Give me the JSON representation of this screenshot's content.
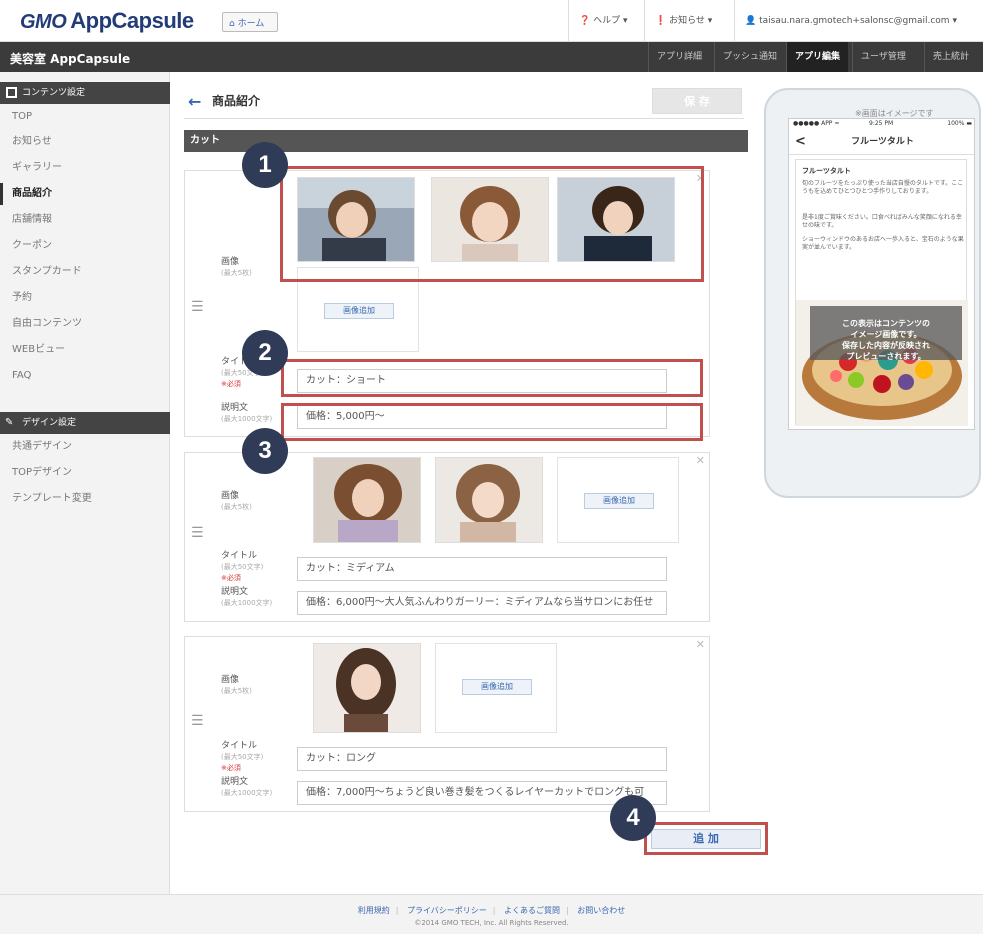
{
  "header": {
    "logo_prefix": "GMO",
    "logo_text": "AppCapsule",
    "home_label": "ホーム",
    "help_label": "ヘルプ ▾",
    "notice_label": "お知らせ ▾",
    "user_label": "taisau.nara.gmotech+salonsc@gmail.com ▾"
  },
  "appbar": {
    "app_name": "美容室 AppCapsule",
    "tabs": [
      "アプリ詳細",
      "プッシュ通知",
      "アプリ編集",
      "ユーザ管理",
      "売上統計"
    ]
  },
  "sidebar": {
    "content_header": "コンテンツ設定",
    "items": [
      "TOP",
      "お知らせ",
      "ギャラリー",
      "商品紹介",
      "店舗情報",
      "クーポン",
      "スタンプカード",
      "予約",
      "自由コンテンツ",
      "WEBビュー",
      "FAQ"
    ],
    "design_header": "デザイン設定",
    "design_items": [
      "共通デザイン",
      "TOPデザイン",
      "テンプレート変更"
    ]
  },
  "main": {
    "back_icon": "←",
    "title": "商品紹介",
    "save_label": "保 存",
    "section": "カット",
    "image_label": "画像",
    "image_sub": "(最大5枚)",
    "title_label": "タイトル",
    "title_sub": "(最大50文字)",
    "required": "※必須",
    "desc_label": "説明文",
    "desc_sub": "(最大1000文字)",
    "add_image_label": "画像追加",
    "items": [
      {
        "title": "カット：ショート",
        "desc": "価格：5,000円〜"
      },
      {
        "title": "カット：ミディアム",
        "desc": "価格：6,000円〜大人気ふんわりガーリー：ミディアムなら当サロンにお任せ"
      },
      {
        "title": "カット：ロング",
        "desc": "価格：7,000円〜ちょうど良い巻き髪をつくるレイヤーカットでロングも可"
      }
    ],
    "add_label": "追 加"
  },
  "phone": {
    "note": "※画面はイメージです",
    "status_left": "●●●●● APP ≈",
    "status_time": "9:25 PM",
    "status_right": "100% ▬",
    "nav_title": "フルーツタルト",
    "back": "<",
    "subtitle": "フルーツタルト",
    "body_1": "旬のフルーツをたっぷり使った当店自慢のタルトです。ここうもを込めてひとつひとつ手作りしております。",
    "body_2": "是非1度ご賞味ください。口食べればみんな笑顔になれる幸せの味です。",
    "body_3": "ショーウィンドウのあるお店へ一歩入ると、宝石のような果実が並んでいます。",
    "overlay": "この表示はコンテンツの\nイメージ画像です。\n保存した内容が反映され\nプレビューされます。"
  },
  "footer": {
    "links": [
      "利用規約",
      "プライバシーポリシー",
      "よくあるご質問",
      "お問い合わせ"
    ],
    "copyright": "©2014 GMO TECH, Inc. All Rights Reserved."
  },
  "callouts": [
    "1",
    "2",
    "3",
    "4"
  ],
  "colors": {
    "accent": "#3a68b0",
    "callout": "#c0504d",
    "badge": "#2f3b57",
    "dark_bar": "#3b3b3b"
  }
}
